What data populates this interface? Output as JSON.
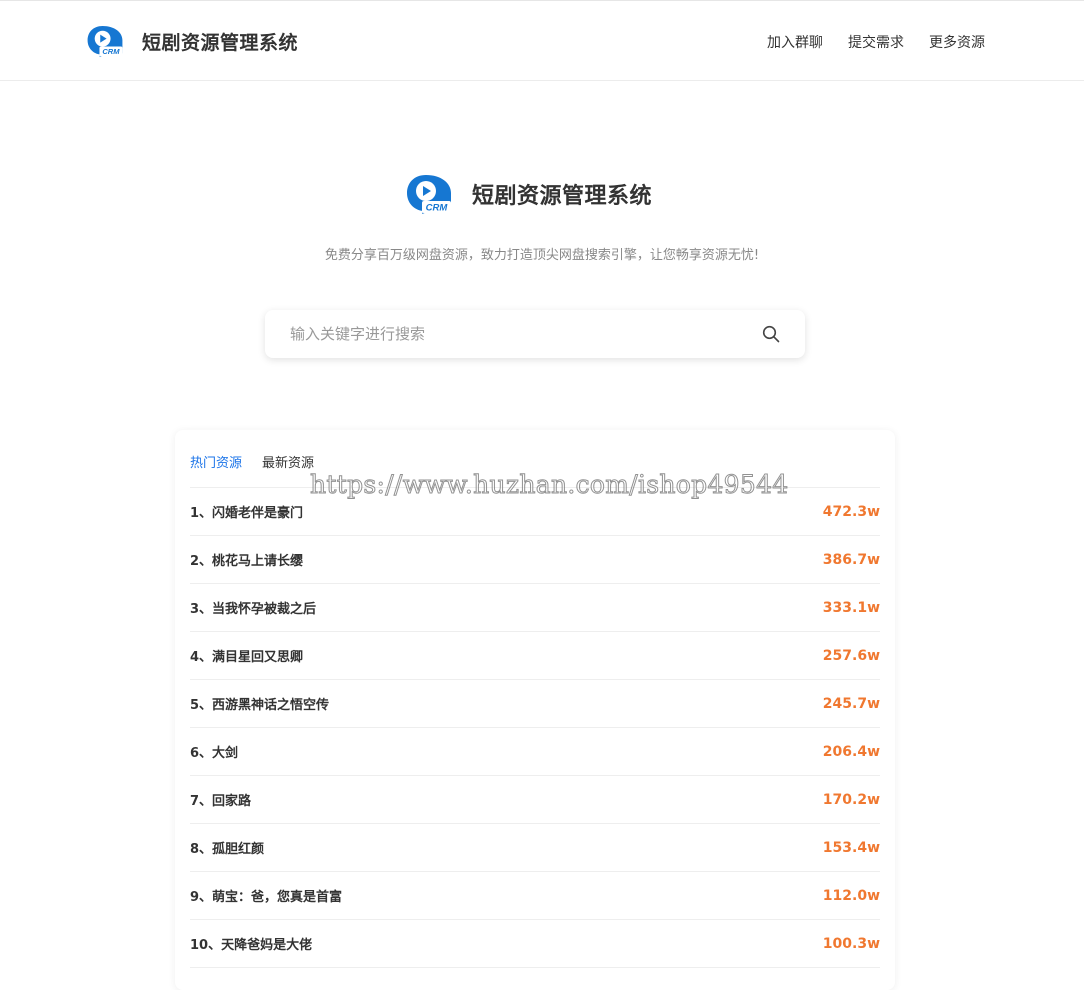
{
  "header": {
    "brand": "短剧资源管理系统",
    "nav": [
      "加入群聊",
      "提交需求",
      "更多资源"
    ]
  },
  "hero": {
    "title": "短剧资源管理系统",
    "tagline": "免费分享百万级网盘资源，致力打造顶尖网盘搜索引擎，让您畅享资源无忧!"
  },
  "search": {
    "placeholder": "输入关键字进行搜索",
    "value": ""
  },
  "logo": {
    "text": "CRM",
    "color": "#1677d2"
  },
  "tabs": [
    {
      "label": "热门资源",
      "active": true
    },
    {
      "label": "最新资源",
      "active": false
    }
  ],
  "list": [
    {
      "title": "1、闪婚老伴是豪门",
      "count": "472.3w"
    },
    {
      "title": "2、桃花马上请长缨",
      "count": "386.7w"
    },
    {
      "title": "3、当我怀孕被裁之后",
      "count": "333.1w"
    },
    {
      "title": "4、满目星回又思卿",
      "count": "257.6w"
    },
    {
      "title": "5、西游黑神话之悟空传",
      "count": "245.7w"
    },
    {
      "title": "6、大剑",
      "count": "206.4w"
    },
    {
      "title": "7、回家路",
      "count": "170.2w"
    },
    {
      "title": "8、孤胆红颜",
      "count": "153.4w"
    },
    {
      "title": "9、萌宝：爸，您真是首富",
      "count": "112.0w"
    },
    {
      "title": "10、天降爸妈是大佬",
      "count": "100.3w"
    }
  ],
  "watermark": "https://www.huzhan.com/ishop49544",
  "colors": {
    "accent": "#1a73e8",
    "count": "#f07830"
  }
}
